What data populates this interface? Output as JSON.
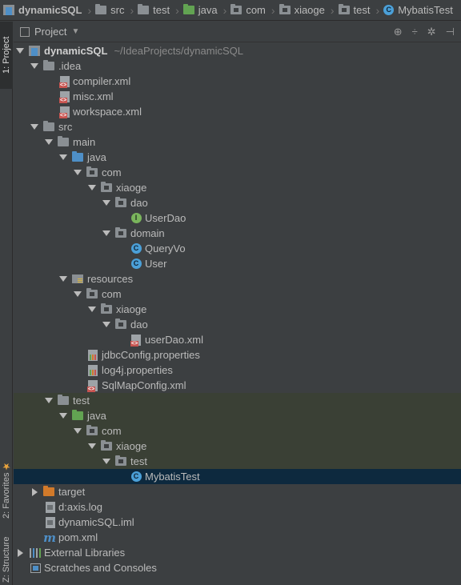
{
  "breadcrumb": {
    "items": [
      {
        "label": "dynamicSQL",
        "icon": "project-icon",
        "bold": true
      },
      {
        "label": "src",
        "icon": "folder-icon"
      },
      {
        "label": "test",
        "icon": "folder-icon"
      },
      {
        "label": "java",
        "icon": "test-source-folder-icon"
      },
      {
        "label": "com",
        "icon": "package-icon"
      },
      {
        "label": "xiaoge",
        "icon": "package-icon"
      },
      {
        "label": "test",
        "icon": "package-icon"
      },
      {
        "label": "MybatisTest",
        "icon": "test-class-icon"
      }
    ]
  },
  "tool_windows": {
    "project": "1: Project",
    "favorites": "2: Favorites",
    "structure": "Z: Structure"
  },
  "panel": {
    "title": "Project",
    "dropdown_icon": "chevron-down-icon"
  },
  "tree": {
    "root": {
      "label": "dynamicSQL",
      "hint": "~/IdeaProjects/dynamicSQL"
    },
    "idea": ".idea",
    "compiler": "compiler.xml",
    "misc": "misc.xml",
    "workspace": "workspace.xml",
    "src": "src",
    "main": "main",
    "main_java": "java",
    "main_com": "com",
    "main_xiaoge": "xiaoge",
    "dao": "dao",
    "userdao": "UserDao",
    "domain": "domain",
    "queryvo": "QueryVo",
    "user": "User",
    "resources": "resources",
    "res_com": "com",
    "res_xiaoge": "xiaoge",
    "res_dao": "dao",
    "userdaoxml": "userDao.xml",
    "jdbc": "jdbcConfig.properties",
    "log4j": "log4j.properties",
    "sqlmap": "SqlMapConfig.xml",
    "test": "test",
    "test_java": "java",
    "test_com": "com",
    "test_xiaoge": "xiaoge",
    "test_pkg": "test",
    "mybatistest": "MybatisTest",
    "target": "target",
    "axislog": "d:axis.log",
    "iml": "dynamicSQL.iml",
    "pom": "pom.xml",
    "extlibs": "External Libraries",
    "scratches": "Scratches and Consoles"
  },
  "colors": {
    "background": "#3c3f41",
    "selection": "#0d293e",
    "test_zone": "#3a4035",
    "source_folder": "#4e8fc7",
    "test_folder": "#62a352",
    "excluded_folder": "#d27a2a"
  }
}
